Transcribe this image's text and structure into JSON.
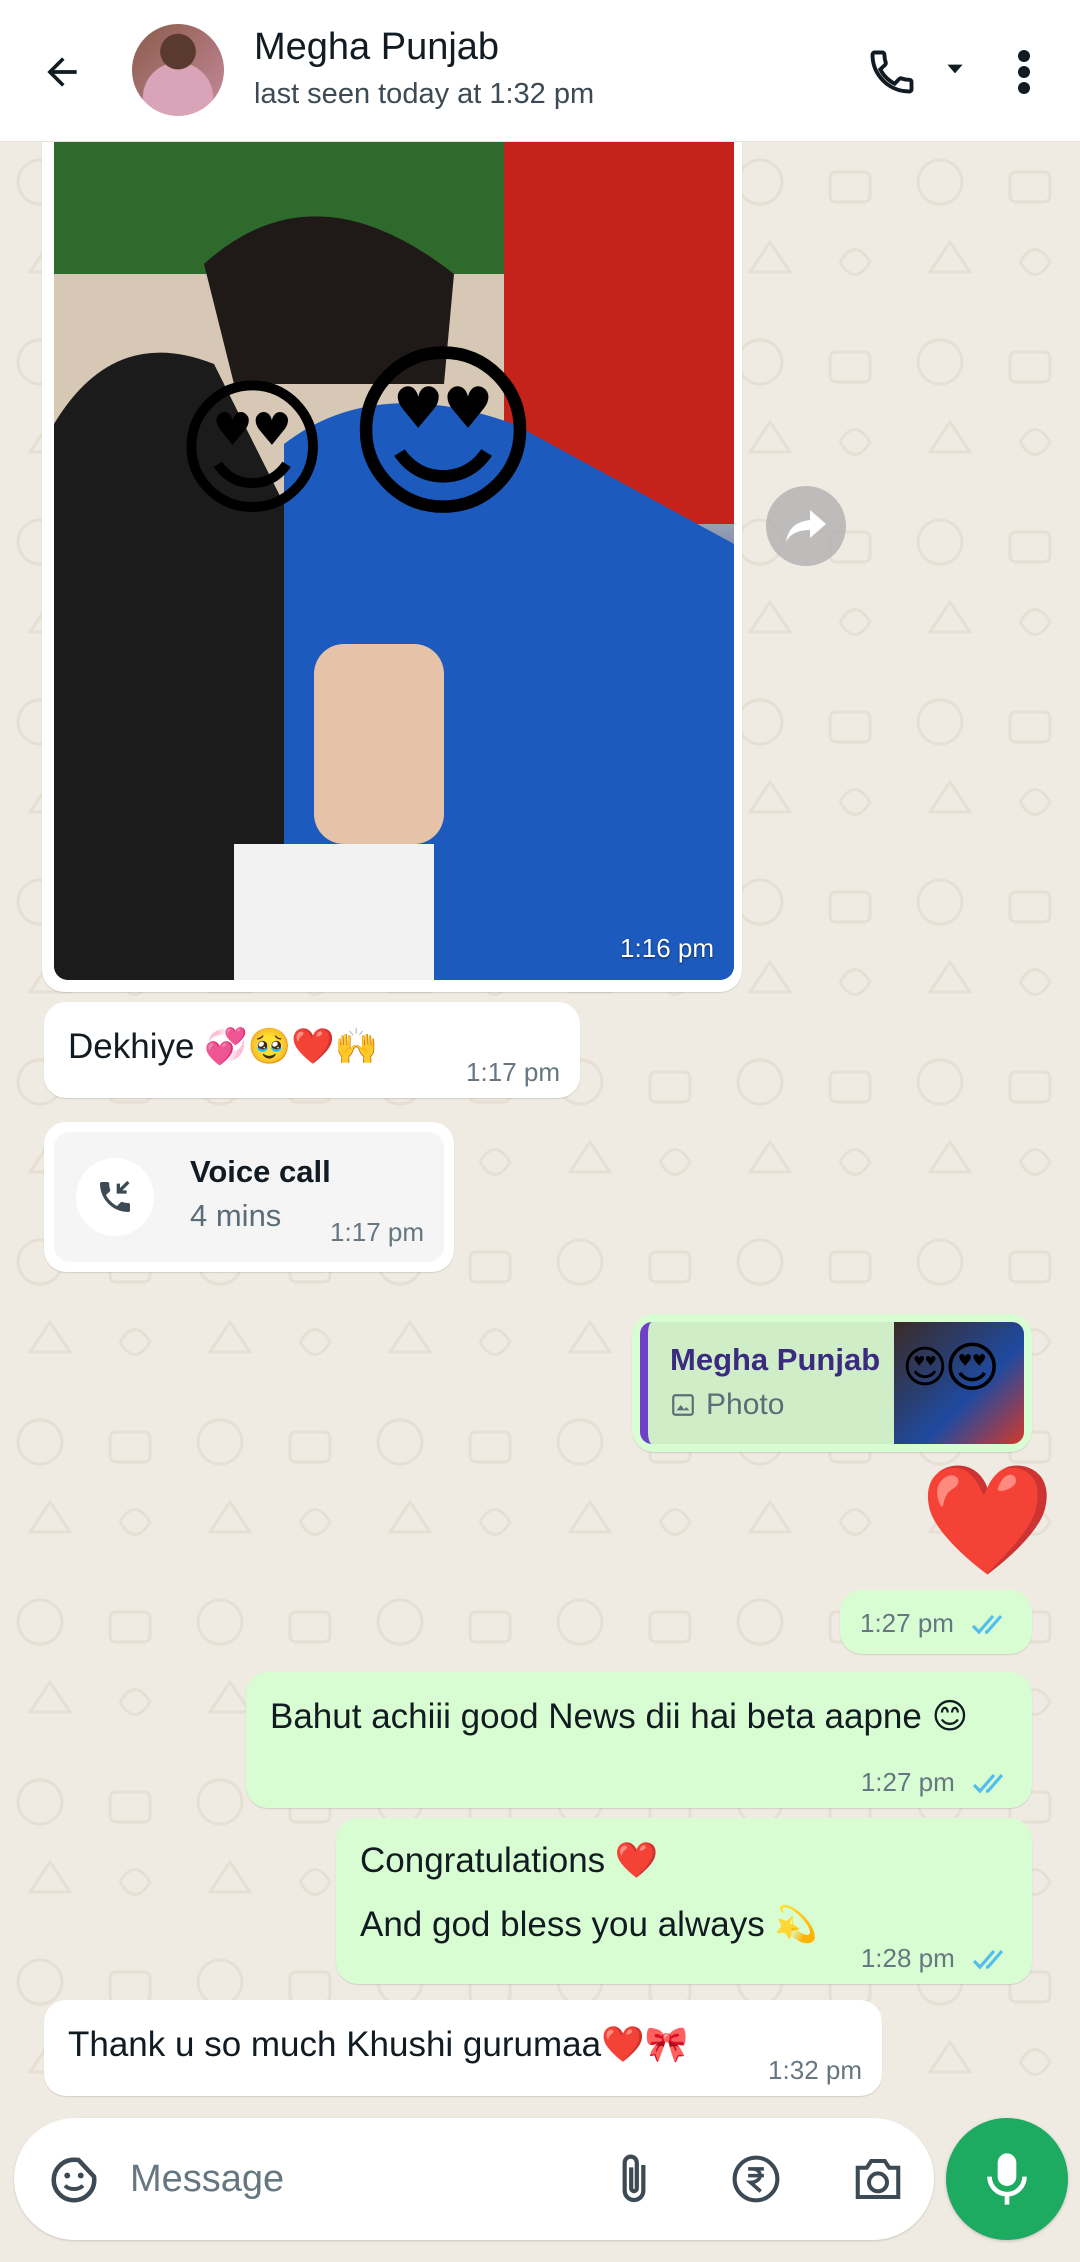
{
  "header": {
    "contact_name": "Megha Punjab",
    "last_seen": "last seen today at 1:32 pm"
  },
  "messages": {
    "photo": {
      "time": "1:16 pm"
    },
    "dekhiye": {
      "text": "Dekhiye 💞🥹❤️🙌",
      "time": "1:17 pm"
    },
    "voice_call": {
      "title": "Voice call",
      "duration": "4 mins",
      "time": "1:17 pm"
    },
    "reply_quote": {
      "name": "Megha Punjab",
      "type": "Photo"
    },
    "heart": {
      "emoji": "❤️",
      "time": "1:27 pm"
    },
    "bahut": {
      "text": "Bahut achiii good News dii hai beta aapne 😊",
      "time": "1:27 pm"
    },
    "congrats": {
      "line1": "Congratulations ❤️",
      "line2": "And god bless you always 💫",
      "time": "1:28 pm"
    },
    "thanku": {
      "text": "Thank u so much Khushi gurumaa❤️🎀",
      "time": "1:32 pm"
    }
  },
  "composer": {
    "placeholder": "Message"
  },
  "colors": {
    "outgoing_bubble": "#d9fdd3",
    "incoming_bubble": "#ffffff",
    "accent_green": "#1daa61",
    "read_ticks": "#53bdeb",
    "chat_background": "#efeae2"
  }
}
